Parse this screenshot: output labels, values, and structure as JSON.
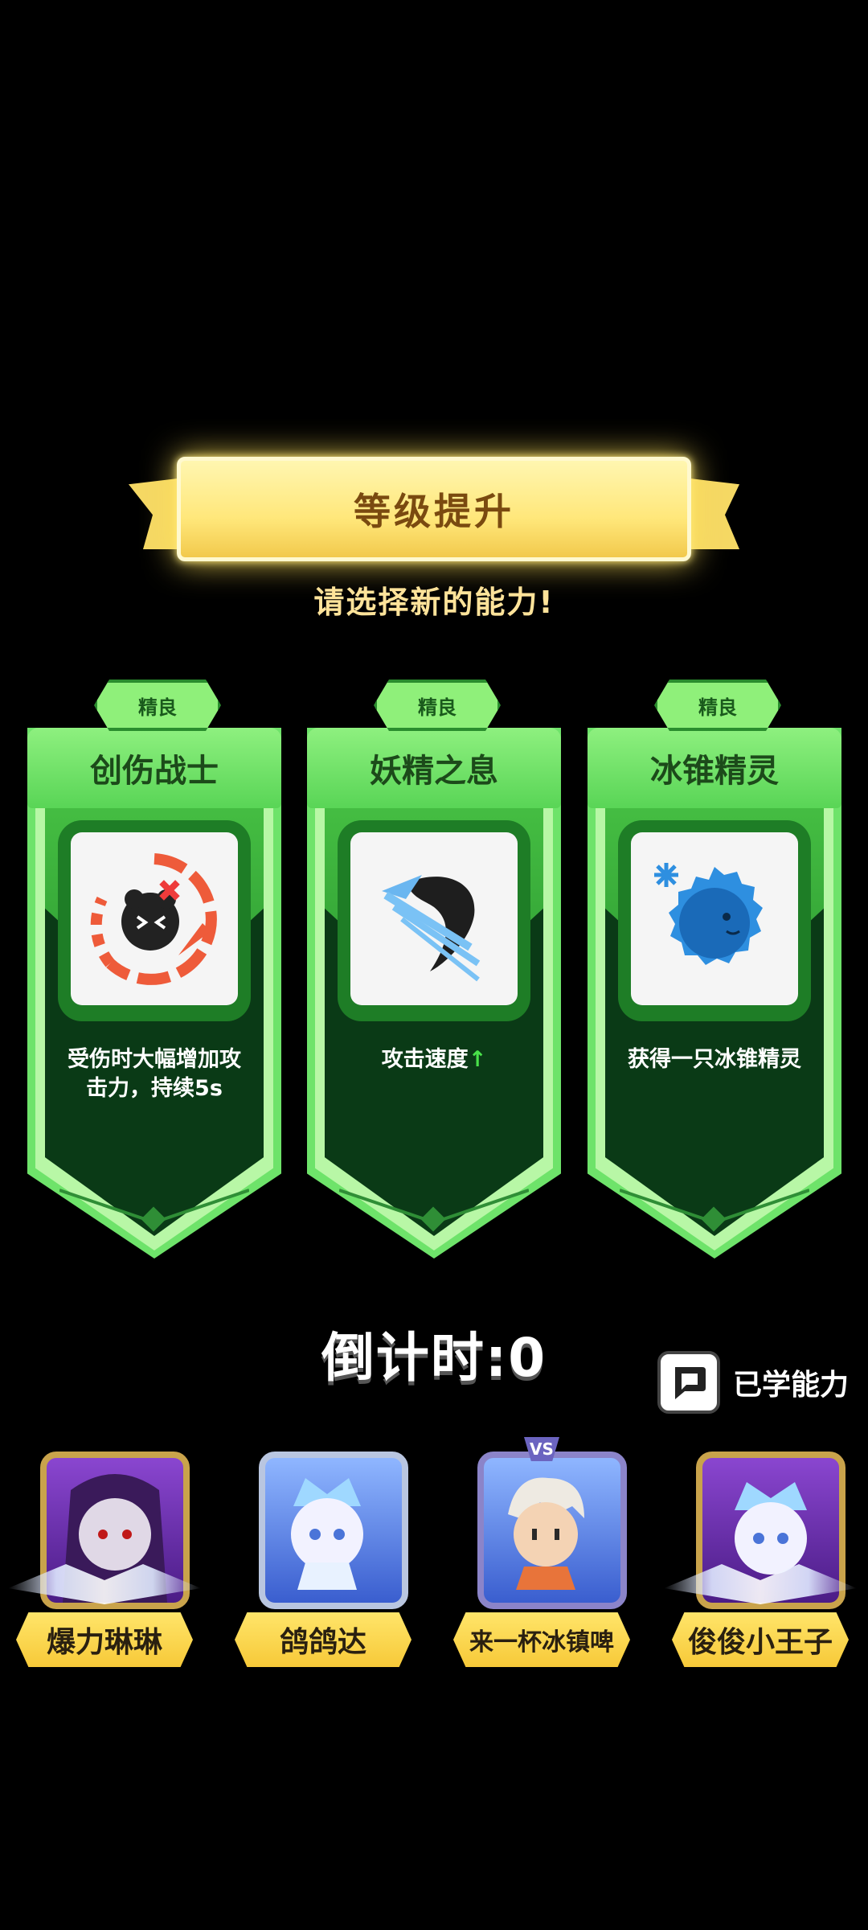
{
  "banner": {
    "title": "等级提升"
  },
  "subtitle": "请选择新的能力!",
  "cards": [
    {
      "rarity": "精良",
      "name": "创伤战士",
      "desc_line1": "受伤时大幅增加攻",
      "desc_line2": "击力，持续5s",
      "icon": "wounded-warrior-icon"
    },
    {
      "rarity": "精良",
      "name": "妖精之息",
      "desc": "攻击速度",
      "desc_arrow": "↑",
      "icon": "fairy-breath-claw-icon"
    },
    {
      "rarity": "精良",
      "name": "冰锥精灵",
      "desc": "获得一只冰锥精灵",
      "icon": "ice-spirit-icon"
    }
  ],
  "countdown": {
    "label": "倒计时:",
    "value": "0"
  },
  "learned_button": {
    "label": "已学能力",
    "icon": "speech-bubble-icon"
  },
  "players": [
    {
      "name": "爆力琳琳",
      "frame": "purple"
    },
    {
      "name": "鸽鸽达",
      "frame": "blue"
    },
    {
      "name": "来一杯冰镇啤",
      "frame": "vs",
      "badge": "VS"
    },
    {
      "name": "俊俊小王子",
      "frame": "purple"
    }
  ],
  "colors": {
    "card_green": "#6ee36a",
    "card_dark": "#0a3a16",
    "banner_gold": "#ffe77a",
    "accent_red": "#ee5b3a",
    "ice_blue": "#2e8fe0"
  }
}
